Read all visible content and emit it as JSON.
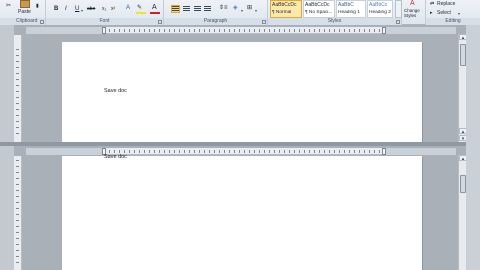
{
  "ribbon": {
    "clipboard": {
      "paste": "Paste",
      "label": "Clipboard"
    },
    "font": {
      "bold": "B",
      "italic": "I",
      "underline": "U",
      "strike": "abe",
      "subscript": "x₂",
      "superscript": "x²",
      "font_color_glyph": "A",
      "highlight_color": "#f5e61c",
      "font_color": "#d81e1e",
      "label": "Font"
    },
    "paragraph": {
      "label": "Paragraph"
    },
    "styles": {
      "label": "Styles",
      "items": [
        {
          "preview": "AaBbCcDc",
          "name": "¶ Normal"
        },
        {
          "preview": "AaBbCcDc",
          "name": "¶ No Spaci..."
        },
        {
          "preview": "AaBbC",
          "name": "Heading 1"
        },
        {
          "preview": "AaBbCc",
          "name": "Heading 2"
        }
      ],
      "change_styles": "Change Styles"
    },
    "editing": {
      "replace": "Replace",
      "select": "Select",
      "label": "Editing"
    }
  },
  "document": {
    "pane1_text": "Save doc",
    "pane2_text": "Save doc"
  }
}
